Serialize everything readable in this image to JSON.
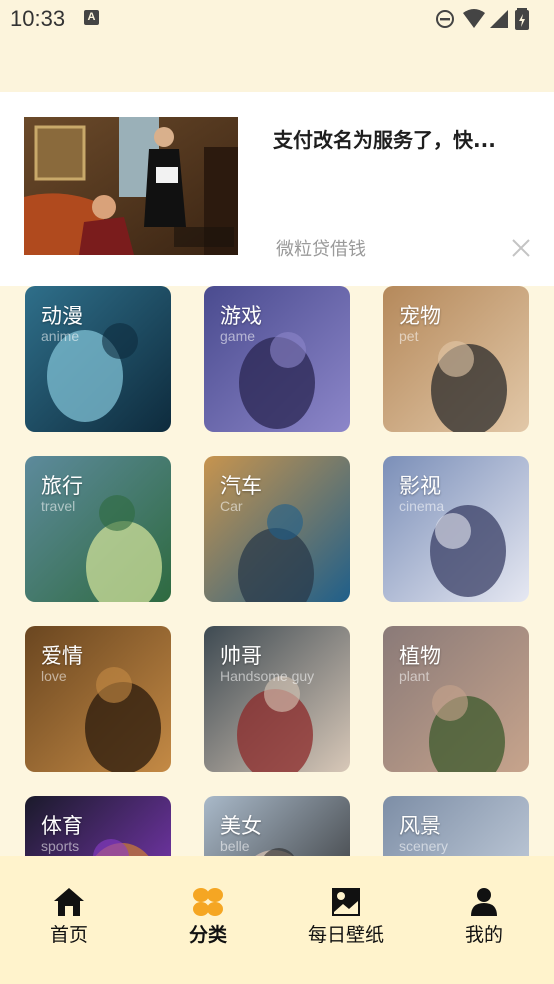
{
  "status_bar": {
    "time": "10:33",
    "notification_icon": "a-badge-icon",
    "icons": [
      "do-not-disturb-icon",
      "wifi-icon",
      "signal-icon",
      "battery-icon"
    ]
  },
  "ad": {
    "title": "支付改名为服务了，快...",
    "source": "微粒贷借钱",
    "close_icon": "close-icon"
  },
  "categories": [
    {
      "name": "动漫",
      "en": "anime"
    },
    {
      "name": "游戏",
      "en": "game"
    },
    {
      "name": "宠物",
      "en": "pet"
    },
    {
      "name": "旅行",
      "en": "travel"
    },
    {
      "name": "汽车",
      "en": "Car"
    },
    {
      "name": "影视",
      "en": "cinema"
    },
    {
      "name": "爱情",
      "en": "love"
    },
    {
      "name": "帅哥",
      "en": "Handsome guy"
    },
    {
      "name": "植物",
      "en": "plant"
    },
    {
      "name": "体育",
      "en": "sports"
    },
    {
      "name": "美女",
      "en": "belle"
    },
    {
      "name": "风景",
      "en": "scenery"
    }
  ],
  "nav": {
    "items": [
      {
        "label": "首页",
        "icon": "home-icon",
        "active": false
      },
      {
        "label": "分类",
        "icon": "category-icon",
        "active": true
      },
      {
        "label": "每日壁纸",
        "icon": "wallpaper-icon",
        "active": false
      },
      {
        "label": "我的",
        "icon": "profile-icon",
        "active": false
      }
    ],
    "accent": "#f5a623"
  },
  "colors": {
    "background": "#fdf6df",
    "nav_background": "#fff3cc",
    "accent": "#f5a623"
  }
}
